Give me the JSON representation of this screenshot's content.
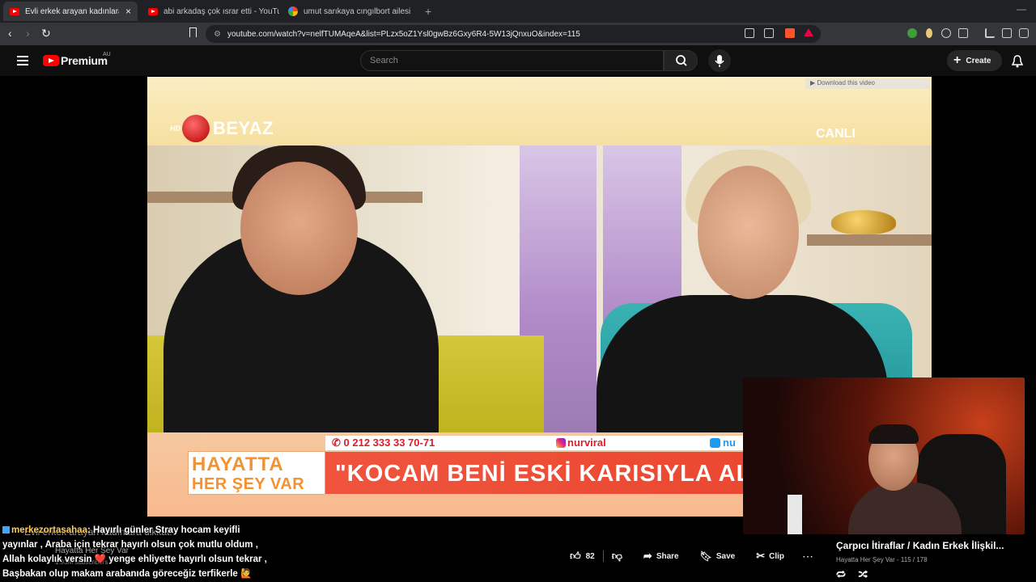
{
  "browser": {
    "tabs": [
      {
        "title": "Evli erkek arayan kadınlara dikkat",
        "active": true
      },
      {
        "title": "abi arkadaş çok ısrar etti - YouTube",
        "active": false
      },
      {
        "title": "umut sarıkaya cıngılbort ailesi - Goog",
        "active": false
      }
    ],
    "url": "youtube.com/watch?v=nelfTUMAqeA&list=PLzx5oZ1Ysl0gwBz6Gxy6R4-5W13jQnxuO&index=115"
  },
  "youtube": {
    "logo_text": "Premium",
    "logo_region": "AU",
    "search_placeholder": "Search",
    "create_label": "Create"
  },
  "video": {
    "download_tip": "▶ Download this video",
    "channel_logo_hd": "HD",
    "channel_logo": "BEYAZ",
    "live_label": "CANLI",
    "phone": "0 212 333 33 70-71",
    "instagram": "nurviral",
    "twitter": "nu",
    "show_title_1": "HAYATTA",
    "show_title_2": "HER ŞEY VAR",
    "headline": "\"KOCAM BENİ ESKİ KARISIYLA AL"
  },
  "overlay_chat": {
    "username": "merkezortasahaa",
    "lines": [
      "Hayırlı günler Stray hocam keyifli",
      "yayınlar , Araba için tekrar hayırlı olsun çok mutlu oldum ,",
      "Allah kolaylık versin ❤️ yenge ehliyette hayırlı olsun tekrar ,",
      "Başbakan olup makam arabanıda göreceğiz terfikerle 🙋"
    ]
  },
  "below_video": {
    "title": "Evli erkek arayan kadınlara dikkat!",
    "channel": "Hayatta Her Şey Var",
    "subscribers": "1.93M subscribers",
    "like_count": "82",
    "share_label": "Share",
    "save_label": "Save",
    "clip_label": "Clip"
  },
  "playlist": {
    "title": "Çarpıcı İtiraflar / Kadın Erkek İlişkil...",
    "channel": "Hayatta Her Şey Var",
    "position": "115 / 178"
  },
  "colors": {
    "youtube_red": "#ff0000",
    "lower_third_red": "#e8432c",
    "show_orange": "#f39233"
  }
}
